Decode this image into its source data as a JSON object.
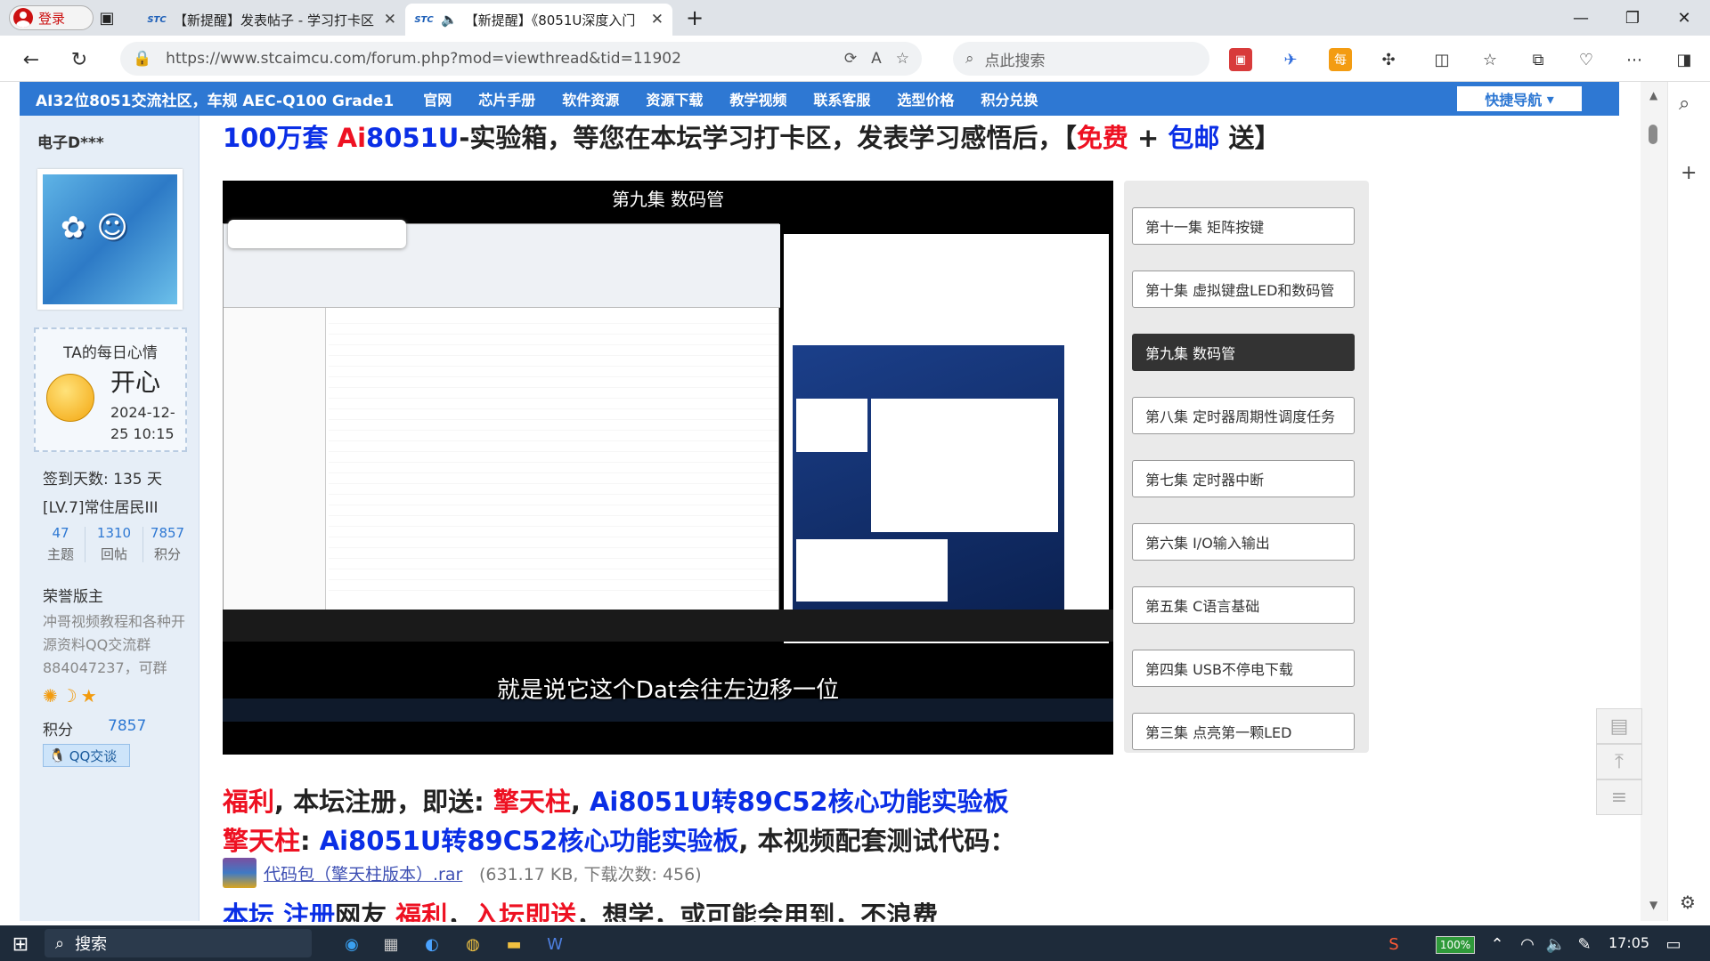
{
  "browser": {
    "login_label": "登录",
    "tabs": [
      {
        "favicon": "STC",
        "title": "【新提醒】发表帖子 - 学习打卡区"
      },
      {
        "favicon": "STC",
        "title": "【新提醒】《8051U深度入门"
      }
    ],
    "url": "https://www.stcaimcu.com/forum.php?mod=viewthread&tid=11902",
    "search_placeholder": "点此搜索"
  },
  "forum_nav": {
    "brand": "AI32位8051交流社区，车规 AEC-Q100 Grade1",
    "items": [
      "官网",
      "芯片手册",
      "软件资源",
      "资源下载",
      "教学视频",
      "联系客服",
      "选型价格",
      "积分兑换"
    ],
    "quick_nav": "快捷导航"
  },
  "sidebar": {
    "username": "电子D***",
    "mood_title": "TA的每日心情",
    "mood": "开心",
    "mood_date": "2024-12-25 10:15",
    "checkin": "签到天数: 135 天",
    "level": "[LV.7]常住居民III",
    "stats": [
      {
        "value": "47",
        "label": "主题"
      },
      {
        "value": "1310",
        "label": "回帖"
      },
      {
        "value": "7857",
        "label": "积分"
      }
    ],
    "honor_title": "荣誉版主",
    "honor_desc": "冲哥视频教程和各种开源资料QQ交流群884047237，可群",
    "points_label": "积分",
    "points_value": "7857",
    "qq_label": "QQ交谈"
  },
  "content": {
    "headline_a": "100万套",
    "headline_b": "Ai",
    "headline_c": "8051U",
    "headline_d": "-实验箱，等您在本坛学习打卡区，发表学习感悟后，【",
    "headline_e": "免费",
    "headline_f": " + ",
    "headline_g": "包邮",
    "headline_h": " 送】",
    "video_title": "第九集 数码管",
    "subtitle": "就是说它这个Dat会往左边移一位",
    "episodes": [
      "第十一集 矩阵按键",
      "第十集 虚拟键盘LED和数码管",
      "第九集 数码管",
      "第八集 定时器周期性调度任务",
      "第七集 定时器中断",
      "第六集 I/O输入输出",
      "第五集 C语言基础",
      "第四集 USB不停电下载",
      "第三集 点亮第一颗LED"
    ],
    "active_episode_index": 2,
    "line1_a": "福利",
    "line1_b": ", 本坛注册，即送: ",
    "line1_c": "擎天柱",
    "line1_d": ", ",
    "line1_e": "Ai8051U转89C52核心功能实验板",
    "line2_a": "擎天柱",
    "line2_b": ": ",
    "line2_c": "Ai8051U转89C52核心功能实验板",
    "line2_d": ", 本视频配套测试代码：",
    "attachment_name": "代码包（擎天柱版本）.rar",
    "attachment_meta": "(631.17 KB, 下载次数: 456)",
    "line3_a": "本坛",
    "line3_b": " 注册",
    "line3_c": "网友",
    "line3_d": " 福利",
    "line3_e": "，",
    "line3_f": "入坛即送",
    "line3_g": "，想学，或可能会用到，不浪费"
  },
  "taskbar": {
    "search_label": "搜索",
    "battery": "100%",
    "time": "17:05"
  }
}
